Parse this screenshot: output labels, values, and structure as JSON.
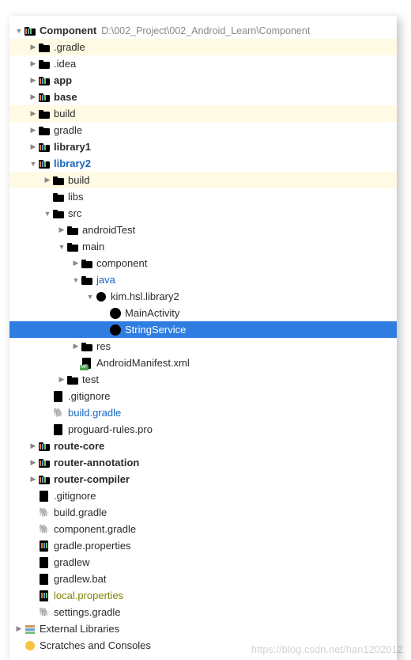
{
  "root": {
    "name": "Component",
    "path": "D:\\002_Project\\002_Android_Learn\\Component"
  },
  "tree": {
    "gradle_dir": ".gradle",
    "idea_dir": ".idea",
    "app": "app",
    "base": "base",
    "build": "build",
    "gradle": "gradle",
    "library1": "library1",
    "library2": {
      "name": "library2",
      "build": "build",
      "libs": "libs",
      "src": {
        "name": "src",
        "androidTest": "androidTest",
        "main": {
          "name": "main",
          "component": "component",
          "java": {
            "name": "java",
            "pkg": {
              "name": "kim.hsl.library2",
              "mainActivity": "MainActivity",
              "stringService": "StringService"
            }
          },
          "res": "res",
          "manifest": "AndroidManifest.xml"
        },
        "test": "test"
      },
      "gitignore": ".gitignore",
      "build_gradle": "build.gradle",
      "proguard": "proguard-rules.pro"
    },
    "route_core": "route-core",
    "router_annotation": "router-annotation",
    "router_compiler": "router-compiler",
    "root_gitignore": ".gitignore",
    "root_build_gradle": "build.gradle",
    "component_gradle": "component.gradle",
    "gradle_properties": "gradle.properties",
    "gradlew": "gradlew",
    "gradlew_bat": "gradlew.bat",
    "local_properties": "local.properties",
    "settings_gradle": "settings.gradle"
  },
  "external_libs": "External Libraries",
  "scratches": "Scratches and Consoles",
  "watermark": "https://blog.csdn.net/han1202012"
}
